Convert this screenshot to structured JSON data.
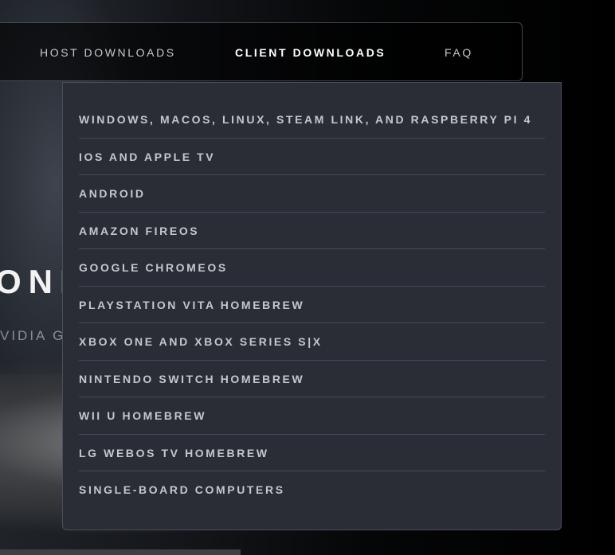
{
  "nav": {
    "items": [
      {
        "label": "HOST DOWNLOADS",
        "active": false
      },
      {
        "label": "CLIENT DOWNLOADS",
        "active": true
      },
      {
        "label": "FAQ",
        "active": false
      }
    ]
  },
  "hero": {
    "title_visible": "ONLIGHT",
    "subtitle_visible": "VIDIA GAMESTREAM CLIENT"
  },
  "client_downloads_menu": {
    "items": [
      "WINDOWS, MACOS, LINUX, STEAM LINK, AND RASPBERRY PI 4",
      "IOS AND APPLE TV",
      "ANDROID",
      "AMAZON FIREOS",
      "GOOGLE CHROMEOS",
      "PLAYSTATION VITA HOMEBREW",
      "XBOX ONE AND XBOX SERIES S|X",
      "NINTENDO SWITCH HOMEBREW",
      "WII U HOMEBREW",
      "LG WEBOS TV HOMEBREW",
      "SINGLE-BOARD COMPUTERS"
    ]
  },
  "colors": {
    "dropdown_bg": "#2a2d35",
    "text": "#c4c7cd",
    "active": "#ffffff"
  }
}
